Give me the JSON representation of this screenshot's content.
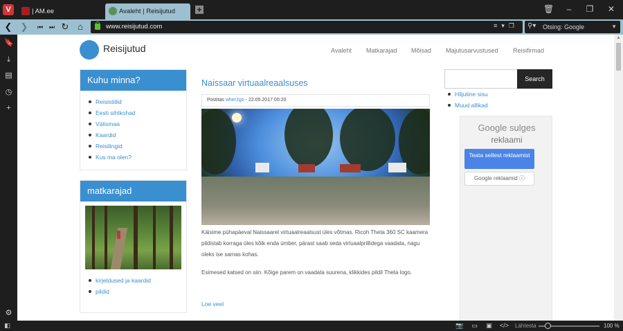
{
  "tabs": [
    {
      "label": "| AM.ee"
    },
    {
      "label": "Avaleht | Reisijutud"
    }
  ],
  "address_bar": {
    "url": "www.reisijutud.com",
    "search_placeholder": "Otsing: Google"
  },
  "site": {
    "name": "Reisijutud",
    "nav": [
      "Avaleht",
      "Matkarajad",
      "Mõisad",
      "Majutusarvustused",
      "Reisifirmad"
    ]
  },
  "left_widgets": {
    "kuhu": {
      "title": "Kuhu minna?",
      "items": [
        "Reisistiilid",
        "Eesti sihtkohad",
        "Välismaa",
        "Kaardid",
        "Reisilingid",
        "Kus ma olen?"
      ]
    },
    "matkarajad": {
      "title": "matkarajad",
      "items": [
        "kirjeldused ja kaardid",
        "pildid"
      ]
    }
  },
  "post": {
    "title": "Naissaar virtuaalreaalsuses",
    "meta_prefix": "Postitas",
    "author": "wher2go",
    "date": "- 22.05.2017 00:20",
    "para1": "Käisime pühapäeval Naissaarel virtuaalreaalsust üles võtmas. Ricoh Theta 360 SC kaamera pildistab korraga üles kõik enda ümber, pärast saab seda virtuaalprillidega vaadata, nagu oleks ise samas kohas.",
    "para2": "Esimesed katsed on siin. Kõige parem on vaadata suurena, klikkides pildil Theta logo.",
    "read_more": "Loe veel"
  },
  "right_sidebar": {
    "search_button": "Search",
    "links": [
      "Hiljutine sisu",
      "Muud allikad"
    ],
    "ad": {
      "brand": "Google",
      "brand_suffix": "sulges",
      "line2": "reklaami",
      "primary_button": "Teata sellest reklaamist",
      "secondary_button": "Google reklaamid ⓘ"
    }
  },
  "status_bar": {
    "zoom_label": "Lähtesta",
    "zoom_value": "100 %",
    "zoom_fraction": 0.15
  }
}
